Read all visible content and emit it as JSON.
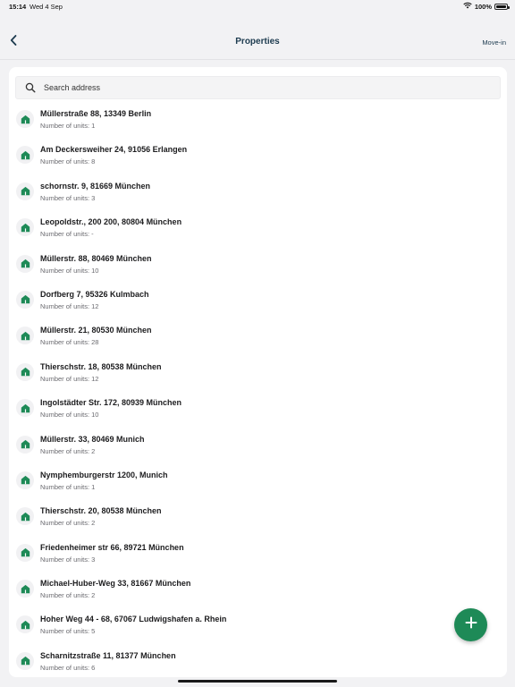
{
  "status_bar": {
    "time": "15:14",
    "date": "Wed 4 Sep",
    "battery": "100%"
  },
  "nav": {
    "title": "Properties",
    "action_label": "Move-in"
  },
  "search": {
    "placeholder": "Search address"
  },
  "properties": [
    {
      "address": "Müllerstraße 88, 13349 Berlin",
      "units": "Number of units: 1"
    },
    {
      "address": "Am Deckersweiher 24, 91056 Erlangen",
      "units": "Number of units: 8"
    },
    {
      "address": "schornstr. 9, 81669 München",
      "units": "Number of units: 3"
    },
    {
      "address": "Leopoldstr., 200 200, 80804 München",
      "units": "Number of units: -"
    },
    {
      "address": "Müllerstr. 88, 80469 München",
      "units": "Number of units: 10"
    },
    {
      "address": "Dorfberg 7, 95326 Kulmbach",
      "units": "Number of units: 12"
    },
    {
      "address": "Müllerstr. 21, 80530 München",
      "units": "Number of units: 28"
    },
    {
      "address": "Thierschstr. 18, 80538 München",
      "units": "Number of units: 12"
    },
    {
      "address": "Ingolstädter Str. 172, 80939 München",
      "units": "Number of units: 10"
    },
    {
      "address": "Müllerstr. 33, 80469 Munich",
      "units": "Number of units: 2"
    },
    {
      "address": "Nymphemburgerstr 1200,  Munich",
      "units": "Number of units: 1"
    },
    {
      "address": "Thierschstr. 20, 80538 München",
      "units": "Number of units: 2"
    },
    {
      "address": "Friedenheimer str 66, 89721 München",
      "units": "Number of units: 3"
    },
    {
      "address": "Michael-Huber-Weg 33, 81667 München",
      "units": "Number of units: 2"
    },
    {
      "address": "Hoher Weg 44 - 68, 67067 Ludwigshafen a. Rhein",
      "units": "Number of units: 5"
    },
    {
      "address": "Scharnitzstraße 11, 81377 München",
      "units": "Number of units: 6"
    }
  ],
  "icons": {
    "property": "house-icon",
    "back": "chevron-left-icon",
    "search": "search-icon",
    "fab": "plus-icon",
    "wifi": "wifi-icon",
    "battery": "battery-icon"
  },
  "colors": {
    "accent_green": "#1e8a57",
    "nav_text": "#1d3b4f",
    "background": "#f2f2f4"
  }
}
